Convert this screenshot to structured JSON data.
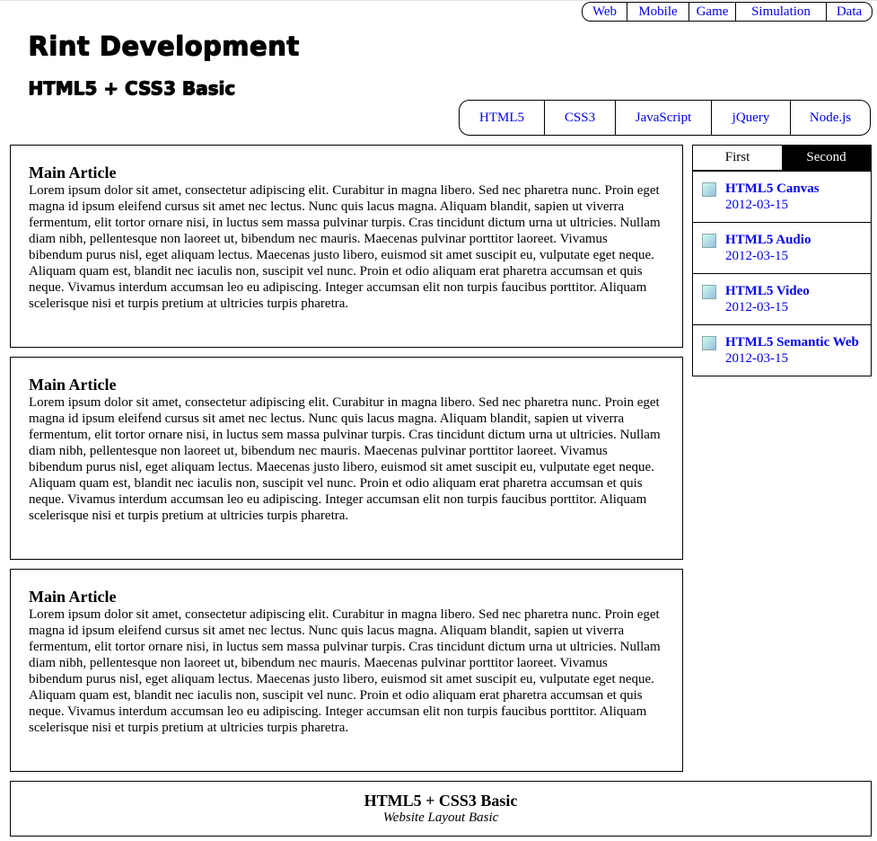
{
  "top_nav": [
    "Web",
    "Mobile",
    "Game",
    "Simulation",
    "Data"
  ],
  "header": {
    "title": "Rint Development",
    "subtitle": "HTML5 + CSS3 Basic"
  },
  "main_nav": [
    "HTML5",
    "CSS3",
    "JavaScript",
    "jQuery",
    "Node.js"
  ],
  "articles": [
    {
      "title": "Main Article",
      "body": "Lorem ipsum dolor sit amet, consectetur adipiscing elit. Curabitur in magna libero. Sed nec pharetra nunc. Proin eget magna id ipsum eleifend cursus sit amet nec lectus. Nunc quis lacus magna. Aliquam blandit, sapien ut viverra fermentum, elit tortor ornare nisi, in luctus sem massa pulvinar turpis. Cras tincidunt dictum urna ut ultricies. Nullam diam nibh, pellentesque non laoreet ut, bibendum nec mauris. Maecenas pulvinar porttitor laoreet. Vivamus bibendum purus nisl, eget aliquam lectus. Maecenas justo libero, euismod sit amet suscipit eu, vulputate eget neque. Aliquam quam est, blandit nec iaculis non, suscipit vel nunc. Proin et odio aliquam erat pharetra accumsan et quis neque. Vivamus interdum accumsan leo eu adipiscing. Integer accumsan elit non turpis faucibus porttitor. Aliquam scelerisque nisi et turpis pretium at ultricies turpis pharetra."
    },
    {
      "title": "Main Article",
      "body": "Lorem ipsum dolor sit amet, consectetur adipiscing elit. Curabitur in magna libero. Sed nec pharetra nunc. Proin eget magna id ipsum eleifend cursus sit amet nec lectus. Nunc quis lacus magna. Aliquam blandit, sapien ut viverra fermentum, elit tortor ornare nisi, in luctus sem massa pulvinar turpis. Cras tincidunt dictum urna ut ultricies. Nullam diam nibh, pellentesque non laoreet ut, bibendum nec mauris. Maecenas pulvinar porttitor laoreet. Vivamus bibendum purus nisl, eget aliquam lectus. Maecenas justo libero, euismod sit amet suscipit eu, vulputate eget neque. Aliquam quam est, blandit nec iaculis non, suscipit vel nunc. Proin et odio aliquam erat pharetra accumsan et quis neque. Vivamus interdum accumsan leo eu adipiscing. Integer accumsan elit non turpis faucibus porttitor. Aliquam scelerisque nisi et turpis pretium at ultricies turpis pharetra."
    },
    {
      "title": "Main Article",
      "body": "Lorem ipsum dolor sit amet, consectetur adipiscing elit. Curabitur in magna libero. Sed nec pharetra nunc. Proin eget magna id ipsum eleifend cursus sit amet nec lectus. Nunc quis lacus magna. Aliquam blandit, sapien ut viverra fermentum, elit tortor ornare nisi, in luctus sem massa pulvinar turpis. Cras tincidunt dictum urna ut ultricies. Nullam diam nibh, pellentesque non laoreet ut, bibendum nec mauris. Maecenas pulvinar porttitor laoreet. Vivamus bibendum purus nisl, eget aliquam lectus. Maecenas justo libero, euismod sit amet suscipit eu, vulputate eget neque. Aliquam quam est, blandit nec iaculis non, suscipit vel nunc. Proin et odio aliquam erat pharetra accumsan et quis neque. Vivamus interdum accumsan leo eu adipiscing. Integer accumsan elit non turpis faucibus porttitor. Aliquam scelerisque nisi et turpis pretium at ultricies turpis pharetra."
    }
  ],
  "aside": {
    "tabs": [
      {
        "label": "First",
        "active": false
      },
      {
        "label": "Second",
        "active": true
      }
    ],
    "items": [
      {
        "title": "HTML5 Canvas",
        "date": "2012-03-15",
        "icon": "broken-image-icon"
      },
      {
        "title": "HTML5 Audio",
        "date": "2012-03-15",
        "icon": "broken-image-icon"
      },
      {
        "title": "HTML5 Video",
        "date": "2012-03-15",
        "icon": "broken-image-icon"
      },
      {
        "title": "HTML5 Semantic Web",
        "date": "2012-03-15",
        "icon": "broken-image-icon"
      }
    ]
  },
  "footer": {
    "title": "HTML5 + CSS3 Basic",
    "subtitle": "Website Layout Basic"
  },
  "colors": {
    "link": "#0000ee",
    "border": "#000000",
    "active_tab_bg": "#000000",
    "active_tab_text": "#ffffff"
  }
}
